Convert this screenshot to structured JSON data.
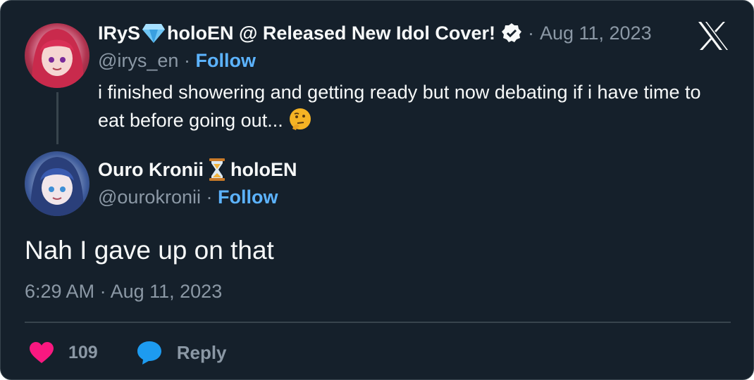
{
  "original_tweet": {
    "author_name_part1": "IRyS",
    "author_name_part2": "holoEN @ Released New Idol Cover!",
    "date": "Aug 11, 2023",
    "handle": "@irys_en",
    "follow_label": "Follow",
    "text": "i finished showering and getting ready but now debating if i have time to eat before going out...",
    "emoji": "🤔"
  },
  "reply_tweet": {
    "author_name_part1": "Ouro Kronii",
    "author_name_part2": "holoEN",
    "handle": "@ourokronii",
    "follow_label": "Follow",
    "text": "Nah I gave up on that",
    "timestamp": "6:29 AM · Aug 11, 2023"
  },
  "actions": {
    "like_count": "109",
    "reply_label": "Reply"
  },
  "separators": {
    "dot": "·"
  },
  "colors": {
    "background": "#15202b",
    "text": "#f7f9f9",
    "muted": "#8b98a5",
    "link": "#5cb3ff",
    "like": "#f91880",
    "reply": "#1d9bf0"
  },
  "icons": {
    "brand": "x-logo-icon",
    "verified": "verified-badge-icon",
    "gem": "gem-emoji-icon",
    "hourglass": "hourglass-emoji-icon",
    "like": "heart-icon",
    "reply": "speech-bubble-icon"
  }
}
